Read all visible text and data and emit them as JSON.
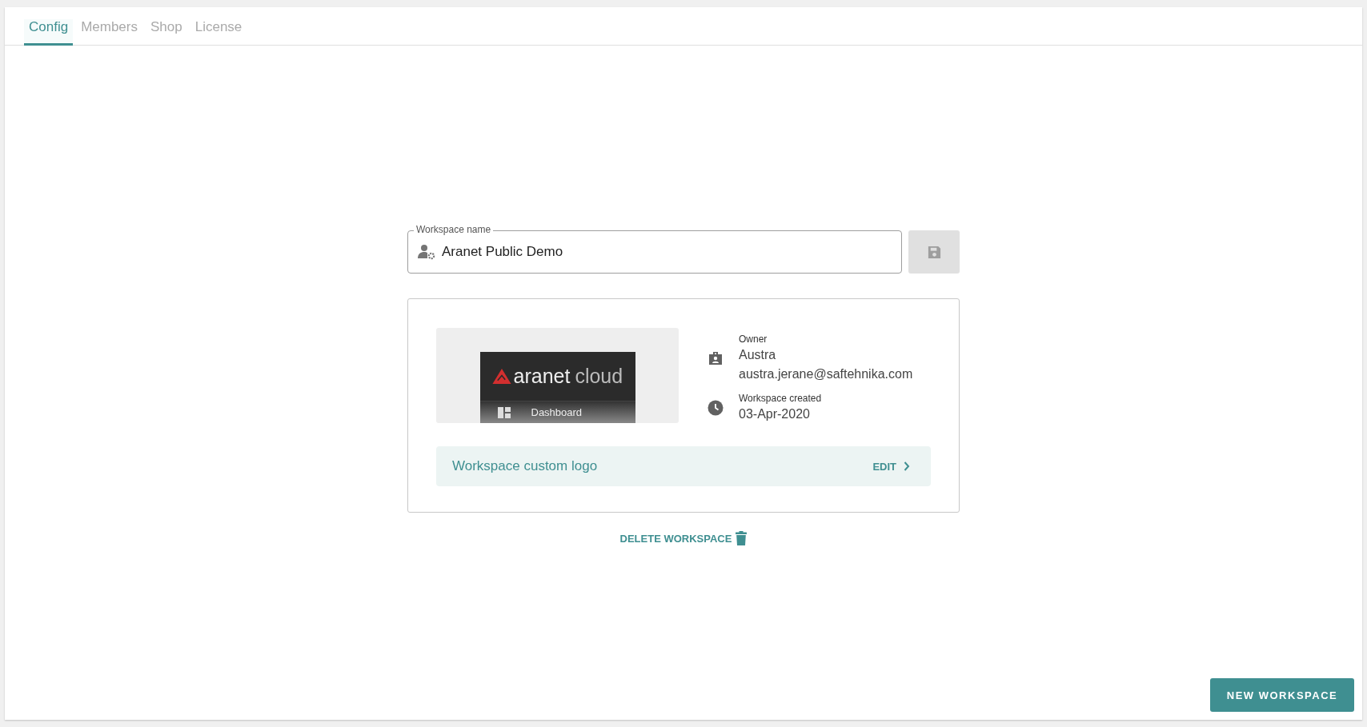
{
  "tabs": [
    {
      "label": "Config",
      "selected": true
    },
    {
      "label": "Members",
      "selected": false
    },
    {
      "label": "Shop",
      "selected": false
    },
    {
      "label": "License",
      "selected": false
    }
  ],
  "workspace_name": {
    "label": "Workspace name",
    "value": "Aranet Public Demo"
  },
  "logo_preview": {
    "brand": "aranet",
    "brand_suffix": "cloud",
    "menu_item": "Dashboard"
  },
  "info": [
    {
      "kind": "owner",
      "label": "Owner",
      "lines": [
        "Austra",
        "austra.jerane@saftehnika.com"
      ]
    },
    {
      "kind": "created",
      "label": "Workspace created",
      "lines": [
        "03-Apr-2020"
      ]
    }
  ],
  "custom_logo": {
    "label": "Workspace custom logo",
    "action": "EDIT"
  },
  "delete_button": "DELETE WORKSPACE",
  "new_workspace_button": "NEW WORKSPACE"
}
